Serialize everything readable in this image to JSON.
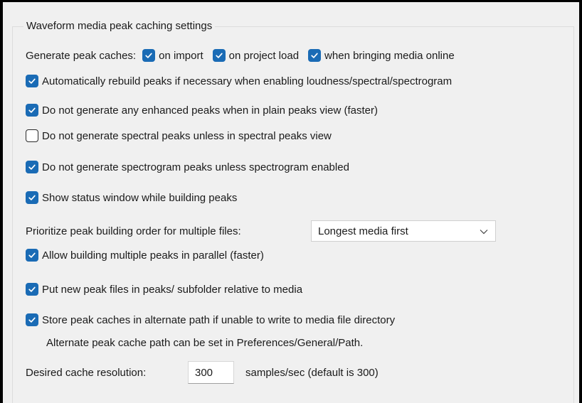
{
  "group": {
    "title": "Waveform media peak caching settings"
  },
  "generate": {
    "label": "Generate peak caches:",
    "on_import": {
      "label": "on import",
      "checked": true
    },
    "on_project_load": {
      "label": "on project load",
      "checked": true
    },
    "media_online": {
      "label": "when bringing media online",
      "checked": true
    }
  },
  "options": [
    {
      "label": "Automatically rebuild peaks if necessary when enabling loudness/spectral/spectrogram",
      "checked": true
    },
    {
      "label": "Do not generate any enhanced peaks when in plain peaks view (faster)",
      "checked": true
    },
    {
      "label": "Do not generate spectral peaks unless in spectral peaks view",
      "checked": false
    },
    {
      "label": "Do not generate spectrogram peaks unless spectrogram enabled",
      "checked": true
    },
    {
      "label": "Show status window while building peaks",
      "checked": true
    }
  ],
  "priority": {
    "label": "Prioritize peak building order for multiple files:",
    "selected": "Longest media first"
  },
  "options2": [
    {
      "label": "Allow building multiple peaks in parallel (faster)",
      "checked": true
    },
    {
      "label": "Put new peak files in peaks/ subfolder relative to media",
      "checked": true
    },
    {
      "label": "Store peak caches in alternate path if unable to write to media file directory",
      "checked": true
    }
  ],
  "alternate_note": "Alternate peak cache path can be set in Preferences/General/Path.",
  "resolution": {
    "label": "Desired cache resolution:",
    "value": "300",
    "suffix": "samples/sec (default is 300)"
  },
  "colors": {
    "checkbox_checked": "#1a6bb5",
    "panel_background": "#f0f0f0"
  }
}
